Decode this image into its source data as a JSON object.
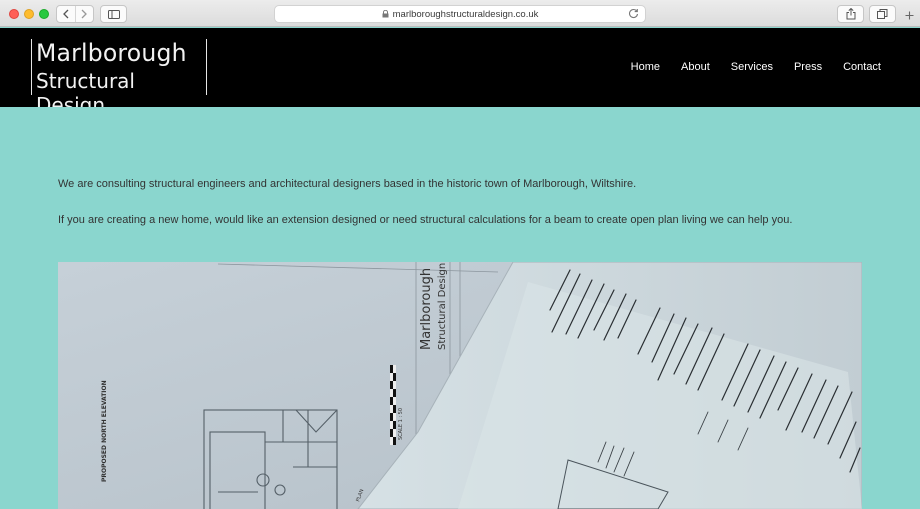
{
  "browser": {
    "url": "marlboroughstructuraldesign.co.uk"
  },
  "header": {
    "logo_line1": "Marlborough",
    "logo_line2": "Structural Design",
    "nav": [
      "Home",
      "About",
      "Services",
      "Press",
      "Contact"
    ]
  },
  "main": {
    "intro_line1": "We are consulting structural engineers and architectural designers based in the historic town of Marlborough, Wiltshire.",
    "intro_line2": "If you are creating a new home, would like an extension designed or need structural calculations for a beam to create open plan living we can help you."
  },
  "photo": {
    "drawing_title": "PROPOSED NORTH ELEVATION",
    "stamp_line1": "Marlborough",
    "stamp_line2": "Structural Design",
    "scale_label": "SCALE 1 : 50",
    "plan_label": "PLAN",
    "alt": "structural drawings and calculations"
  },
  "colors": {
    "page_bg": "#8ad6ce",
    "header_bg": "#000000",
    "nav_text": "#ffffff",
    "body_text": "#333333"
  }
}
